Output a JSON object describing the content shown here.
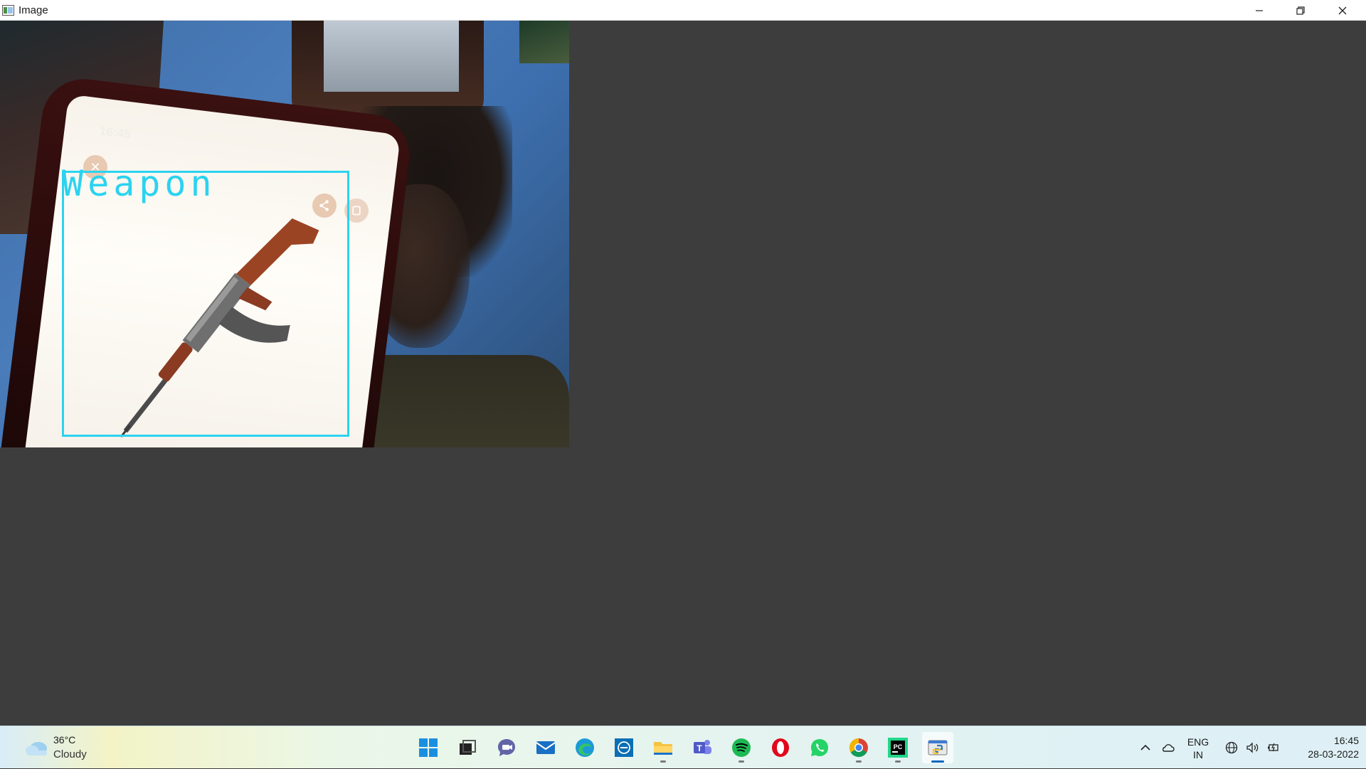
{
  "window": {
    "title": "Image",
    "controls": {
      "minimize_icon": "minimize-icon",
      "maximize_icon": "restore-icon",
      "close_icon": "close-icon"
    }
  },
  "camera_view": {
    "detection": {
      "label": "Weapon",
      "box_color": "#2bd3f0"
    },
    "phone_screen": {
      "time": "16:45"
    }
  },
  "taskbar": {
    "weather": {
      "temperature": "36°C",
      "condition": "Cloudy"
    },
    "apps": [
      {
        "name": "Start",
        "icon": "windows-icon"
      },
      {
        "name": "Task View",
        "icon": "task-view-icon"
      },
      {
        "name": "Chat",
        "icon": "chat-icon"
      },
      {
        "name": "Mail",
        "icon": "mail-icon"
      },
      {
        "name": "Microsoft Edge",
        "icon": "edge-icon"
      },
      {
        "name": "Dell",
        "icon": "dell-icon"
      },
      {
        "name": "File Explorer",
        "icon": "folder-icon"
      },
      {
        "name": "Microsoft Teams",
        "icon": "teams-icon"
      },
      {
        "name": "Spotify",
        "icon": "spotify-icon"
      },
      {
        "name": "Opera",
        "icon": "opera-icon"
      },
      {
        "name": "WhatsApp",
        "icon": "whatsapp-icon"
      },
      {
        "name": "Google Chrome",
        "icon": "chrome-icon"
      },
      {
        "name": "PyCharm",
        "icon": "pycharm-icon"
      },
      {
        "name": "Python",
        "icon": "python-icon"
      }
    ],
    "tray": {
      "language_line1": "ENG",
      "language_line2": "IN",
      "time": "16:45",
      "date": "28-03-2022"
    }
  },
  "colors": {
    "client_background": "#3d3d3d",
    "detection_box": "#2bd3f0",
    "active_indicator": "#0067c0"
  }
}
